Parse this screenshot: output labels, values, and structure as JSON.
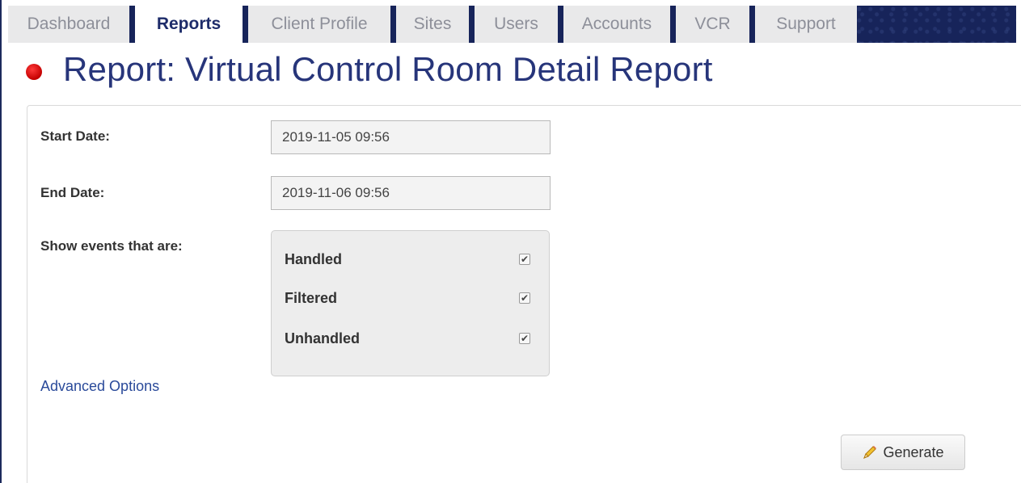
{
  "nav": {
    "tabs": [
      {
        "label": "Dashboard",
        "active": false
      },
      {
        "label": "Reports",
        "active": true
      },
      {
        "label": "Client Profile",
        "active": false
      },
      {
        "label": "Sites",
        "active": false
      },
      {
        "label": "Users",
        "active": false
      },
      {
        "label": "Accounts",
        "active": false
      },
      {
        "label": "VCR",
        "active": false
      },
      {
        "label": "Support",
        "active": false
      }
    ]
  },
  "header": {
    "title": "Report: Virtual Control Room Detail Report"
  },
  "form": {
    "start_date": {
      "label": "Start Date:",
      "value": "2019-11-05 09:56"
    },
    "end_date": {
      "label": "End Date:",
      "value": "2019-11-06 09:56"
    },
    "events": {
      "label": "Show events that are:",
      "options": [
        {
          "label": "Handled",
          "checked": true
        },
        {
          "label": "Filtered",
          "checked": true
        },
        {
          "label": "Unhandled",
          "checked": true
        }
      ]
    },
    "advanced_link": "Advanced Options",
    "generate_label": "Generate",
    "generate_icon": "pencil-icon"
  },
  "colors": {
    "nav_background": "#17245a",
    "title_text": "#27357a",
    "link": "#2a4a9a",
    "status_dot": "#d10000"
  }
}
